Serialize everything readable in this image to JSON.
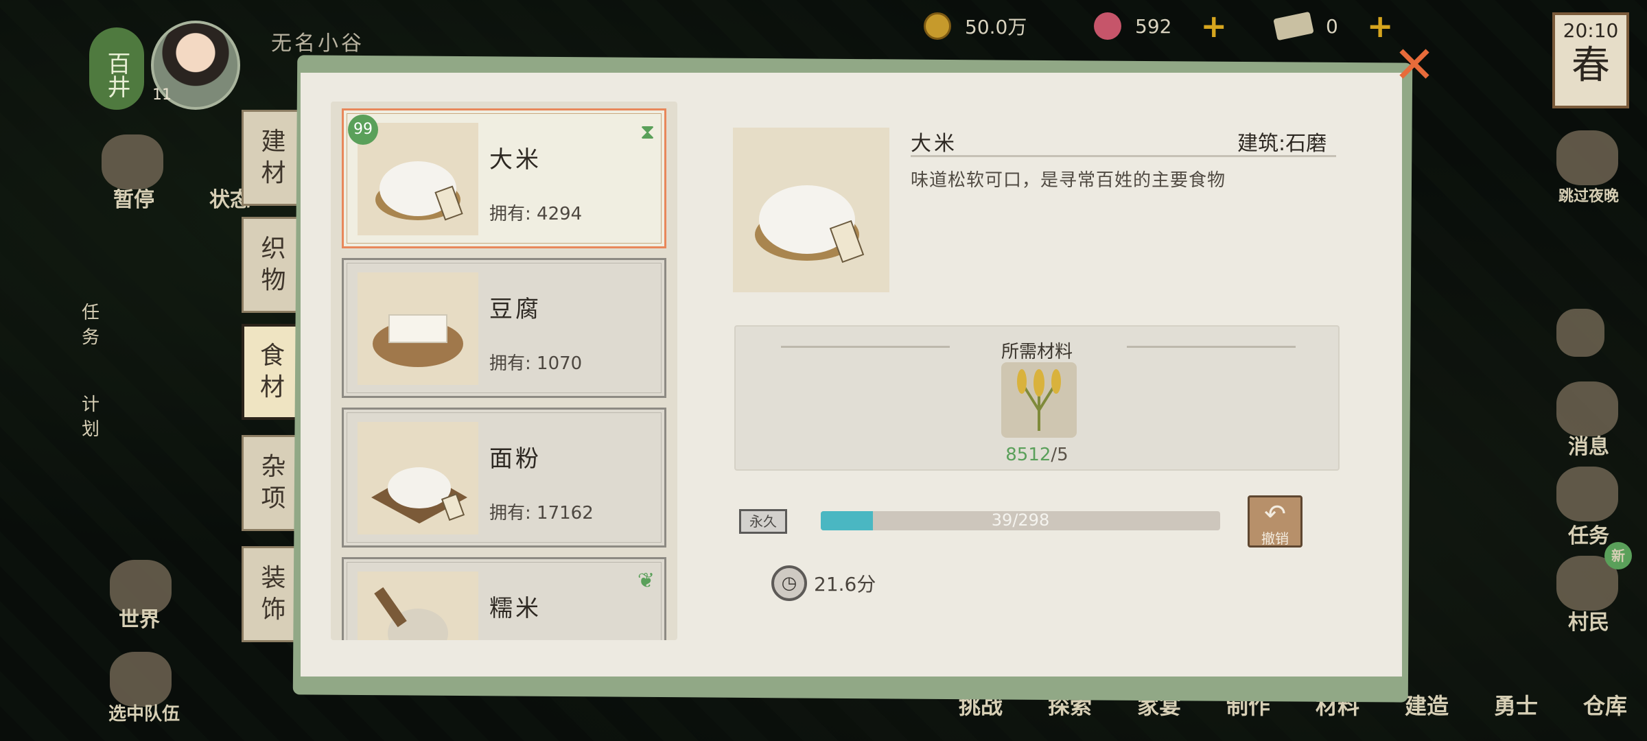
{
  "hud": {
    "rank": "百井",
    "level": "11",
    "town_name": "无名小谷",
    "coins": "50.0万",
    "jade": "592",
    "tickets": "0",
    "time": "20:10",
    "season": "春"
  },
  "side_left": {
    "pause": "暂停",
    "status": "状态",
    "task": "任务",
    "plan": "计划",
    "world": "世界",
    "team": "选中队伍"
  },
  "side_right": {
    "skip_night": "跳过夜晚",
    "messages": "消息",
    "tasks": "任务",
    "villagers": "村民",
    "new_badge": "新"
  },
  "bottom_nav": [
    "挑战",
    "探索",
    "家宴",
    "制作",
    "材料",
    "建造",
    "勇士",
    "仓库"
  ],
  "categories": [
    {
      "label": "建材"
    },
    {
      "label": "织物"
    },
    {
      "label": "食材"
    },
    {
      "label": "杂项"
    },
    {
      "label": "装饰"
    }
  ],
  "items": [
    {
      "name": "大米",
      "owned": "拥有: 4294",
      "badge": "99"
    },
    {
      "name": "豆腐",
      "owned": "拥有: 1070"
    },
    {
      "name": "面粉",
      "owned": "拥有: 17162"
    },
    {
      "name": "糯米",
      "owned": ""
    }
  ],
  "detail": {
    "name": "大米",
    "building": "建筑:石磨",
    "description": "味道松软可口，是寻常百姓的主要食物",
    "materials_title": "所需材料",
    "material_have": "8512",
    "material_need": "/5",
    "permanent_tag": "永久",
    "progress_label": "39/298",
    "progress_fraction": 0.131,
    "cancel_label": "撤销",
    "time": "21.6分"
  },
  "colors": {
    "accent_green": "#5aa05a",
    "progress": "#4ab7c2",
    "close": "#e86b3a",
    "selected_border": "#e8875a"
  }
}
